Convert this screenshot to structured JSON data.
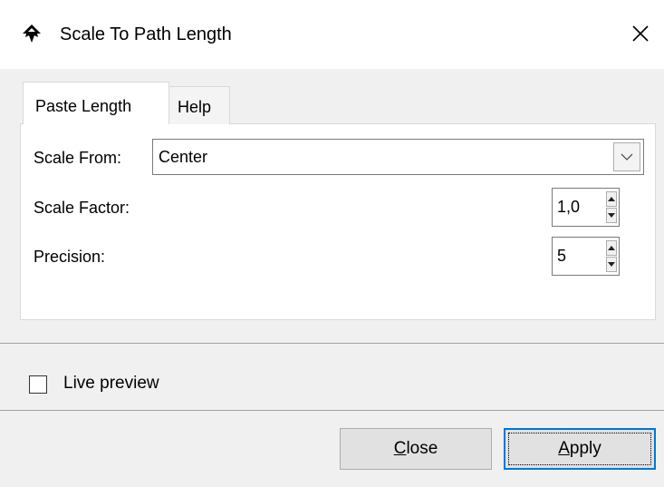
{
  "window": {
    "title": "Scale To Path Length",
    "icon": "inkscape-logo-icon",
    "close_glyph": "✕"
  },
  "tabs": [
    {
      "label": "Paste Length",
      "active": true
    },
    {
      "label": "Help",
      "active": false
    }
  ],
  "form": {
    "scale_from": {
      "label": "Scale From:",
      "value": "Center"
    },
    "scale_factor": {
      "label": "Scale Factor:",
      "value": "1,0"
    },
    "precision": {
      "label": "Precision:",
      "value": "5"
    }
  },
  "live_preview": {
    "label": "Live preview",
    "checked": false
  },
  "buttons": {
    "close": {
      "mnemonic": "C",
      "rest": "lose"
    },
    "apply": {
      "mnemonic": "A",
      "rest": "pply"
    }
  }
}
